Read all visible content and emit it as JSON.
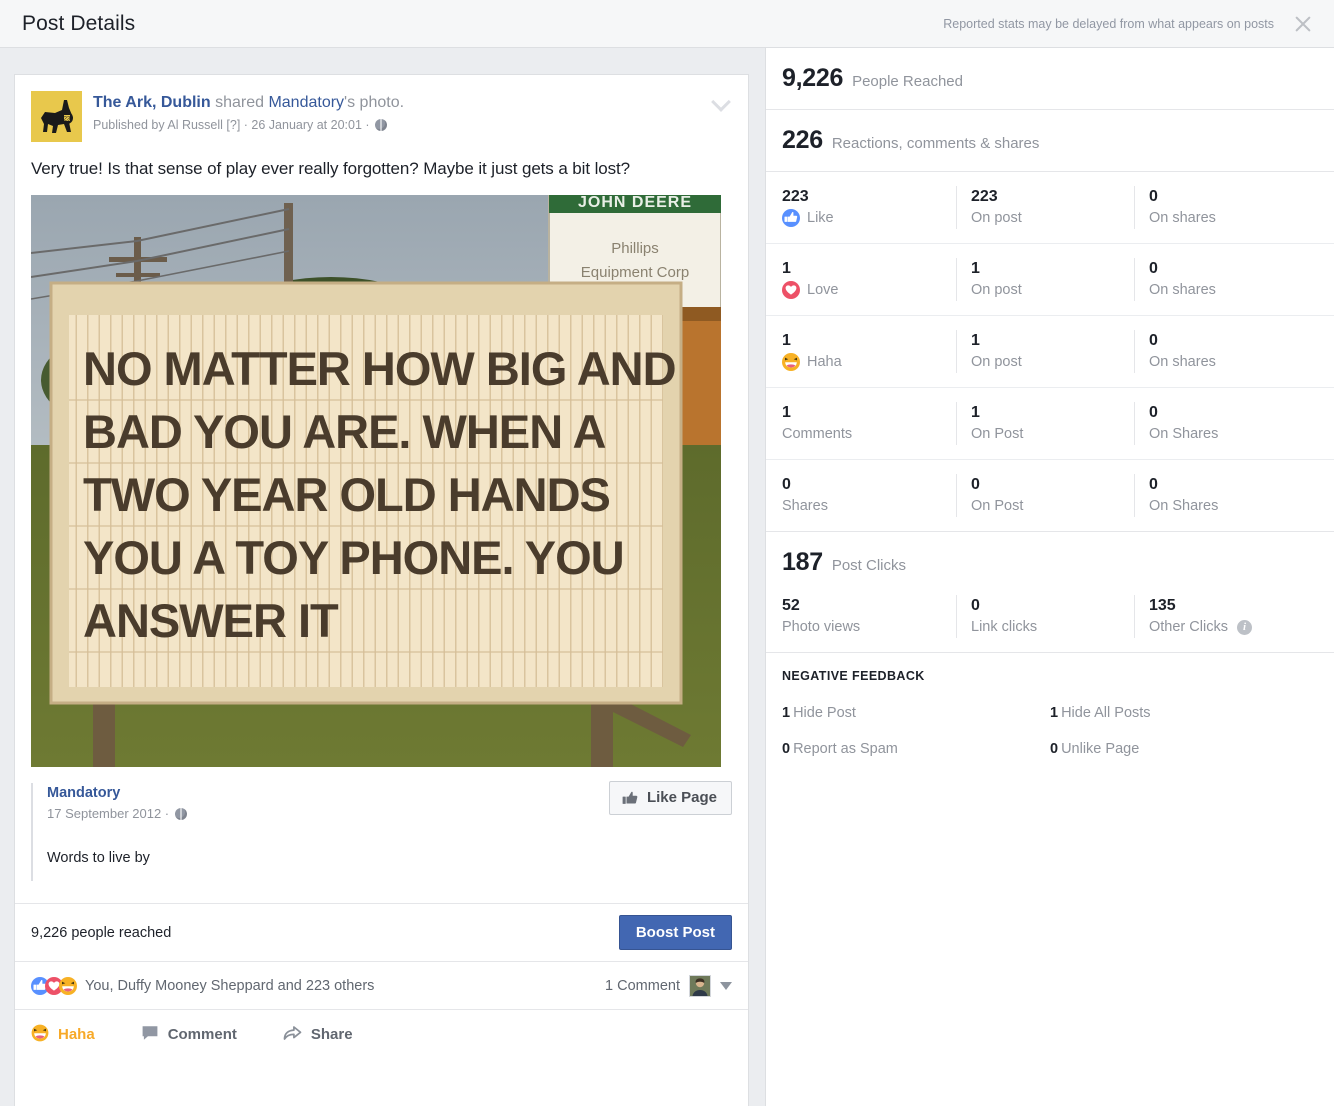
{
  "topbar": {
    "title": "Post Details",
    "note": "Reported stats may be delayed from what appears on posts",
    "close_icon": "close-icon"
  },
  "post": {
    "page_name": "The Ark, Dublin",
    "shared_text": " shared ",
    "shared_page": "Mandatory",
    "shared_suffix": "'s photo.",
    "published_by": "Published by Al Russell [?] · 26 January at 20:01 · ",
    "message": "Very true! Is that sense of play ever really forgotten? Maybe it just gets a bit lost?",
    "chevron_icon": "chevron-down-icon",
    "privacy_icon": "globe-icon",
    "avatar_icon": "page-avatar-donkey"
  },
  "photo": {
    "alt": "Letterboard billboard sign in a grassy lot",
    "sign_lines": [
      "NO MATTER HOW BIG AND",
      "BAD YOU ARE. WHEN  A",
      "TWO YEAR OLD HANDS",
      "YOU A TOY PHONE. YOU",
      "ANSWER  IT"
    ],
    "background_sign_line1": "JOHN DEERE",
    "background_sign_line2": "Phillips",
    "background_sign_line3": "Equipment Corp"
  },
  "attribution": {
    "name": "Mandatory",
    "date": "17 September 2012 · ",
    "body": "Words to live by",
    "like_page_label": "Like Page",
    "like_page_icon": "thumbs-up-icon",
    "privacy_icon": "globe-icon"
  },
  "reach_bar": {
    "text": "9,226 people reached",
    "boost_label": "Boost Post"
  },
  "reaction_summary": {
    "icons": [
      "like-reaction-icon",
      "love-reaction-icon",
      "haha-reaction-icon"
    ],
    "text": "You, Duffy Mooney Sheppard and 223 others",
    "comment_count": "1 Comment",
    "avatar_icon": "commenter-avatar",
    "caret_icon": "caret-down-icon"
  },
  "action_bar": {
    "react_label": "Haha",
    "react_icon": "haha-reaction-icon",
    "comment_label": "Comment",
    "comment_icon": "comment-bubble-icon",
    "share_label": "Share",
    "share_icon": "share-arrow-icon",
    "active_color": "#f7a928"
  },
  "insights": {
    "reach": {
      "value": "9,226",
      "label": "People Reached"
    },
    "engagement": {
      "value": "226",
      "label": "Reactions, comments & shares"
    },
    "metric_rows": [
      {
        "icon": "like-reaction-icon",
        "primary_value": "223",
        "primary_label": "Like",
        "on_post_value": "223",
        "on_post_label": "On post",
        "on_shares_value": "0",
        "on_shares_label": "On shares"
      },
      {
        "icon": "love-reaction-icon",
        "primary_value": "1",
        "primary_label": "Love",
        "on_post_value": "1",
        "on_post_label": "On post",
        "on_shares_value": "0",
        "on_shares_label": "On shares"
      },
      {
        "icon": "haha-reaction-icon",
        "primary_value": "1",
        "primary_label": "Haha",
        "on_post_value": "1",
        "on_post_label": "On post",
        "on_shares_value": "0",
        "on_shares_label": "On shares"
      },
      {
        "icon": null,
        "primary_value": "1",
        "primary_label": "Comments",
        "on_post_value": "1",
        "on_post_label": "On Post",
        "on_shares_value": "0",
        "on_shares_label": "On Shares"
      },
      {
        "icon": null,
        "primary_value": "0",
        "primary_label": "Shares",
        "on_post_value": "0",
        "on_post_label": "On Post",
        "on_shares_value": "0",
        "on_shares_label": "On Shares"
      }
    ],
    "post_clicks": {
      "value": "187",
      "label": "Post Clicks"
    },
    "click_breakdown": [
      {
        "value": "52",
        "label": "Photo views",
        "info": false
      },
      {
        "value": "0",
        "label": "Link clicks",
        "info": false
      },
      {
        "value": "135",
        "label": "Other Clicks",
        "info": true
      }
    ],
    "negative_feedback": {
      "title": "NEGATIVE FEEDBACK",
      "items": [
        {
          "value": "1",
          "label": "Hide Post"
        },
        {
          "value": "1",
          "label": "Hide All Posts"
        },
        {
          "value": "0",
          "label": "Report as Spam"
        },
        {
          "value": "0",
          "label": "Unlike Page"
        }
      ]
    }
  },
  "colors": {
    "brand_blue": "#4267b2",
    "link_blue": "#365899",
    "page_bg": "#ebedf0",
    "like_blue": "#5890ff",
    "love_red": "#ed5167",
    "haha_yellow": "#f7b125"
  }
}
